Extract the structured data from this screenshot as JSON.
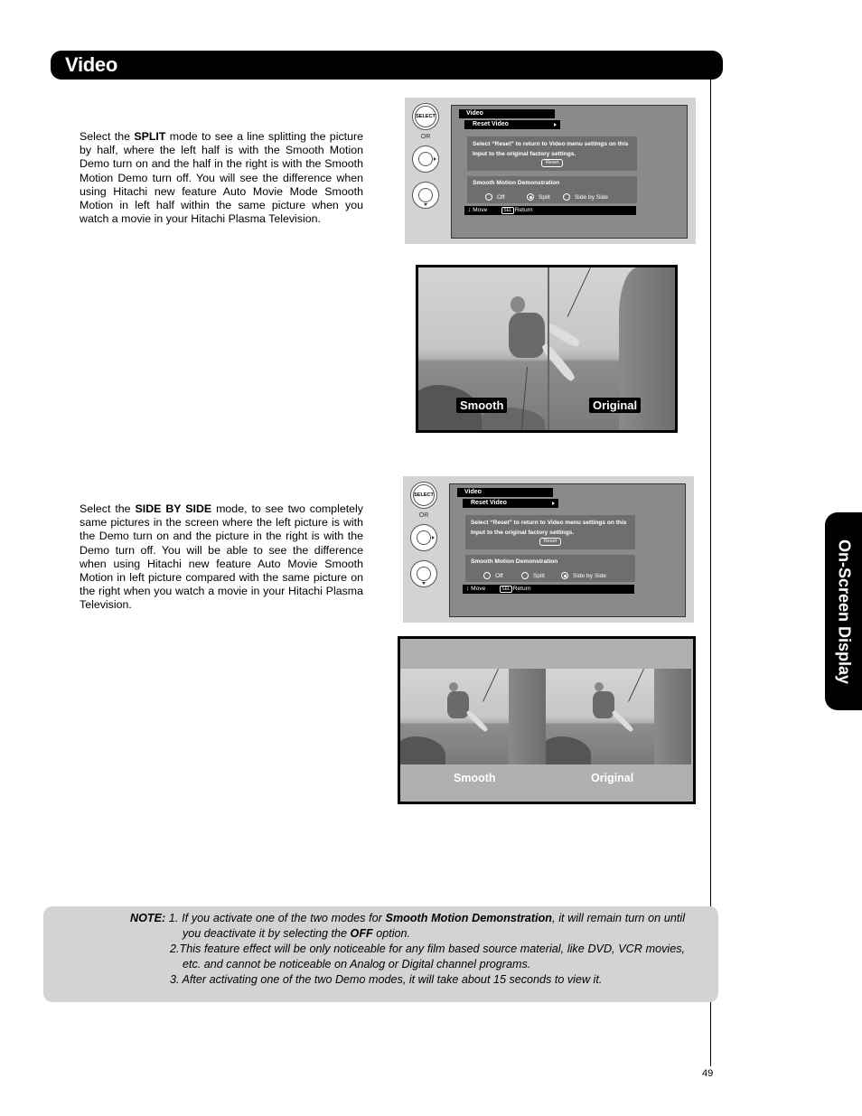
{
  "header": {
    "title": "Video"
  },
  "side_tab": {
    "label": "On-Screen Display"
  },
  "section_split": {
    "text_prefix": "Select the ",
    "mode_name": "SPLIT",
    "text_suffix": " mode to see a line splitting the picture by half, where the left half is with the Smooth Motion Demo turn on and the half in the right is with the Smooth Motion Demo turn off. You will see the difference when using Hitachi new feature Auto Movie Mode Smooth Motion in left half within the same picture when you watch a movie in your Hitachi Plasma Television."
  },
  "section_sbs": {
    "text_prefix": "Select the ",
    "mode_name": "SIDE BY SIDE",
    "text_suffix": " mode, to see two completely same pictures in the screen where the left picture is with the Demo turn on and the picture in the right is with the Demo turn off. You will be able to see the difference when using Hitachi new feature Auto Movie Smooth Motion in left picture compared with the same picture on the right when you watch a movie in your Hitachi Plasma Television."
  },
  "remote": {
    "select_label": "SELECT",
    "or_label": "OR"
  },
  "osd_menus": [
    {
      "menu_title": "Video",
      "submenu": "Reset Video",
      "reset_description": "Select “Reset” to return to Video menu settings on this Input to the original factory settings.",
      "reset_button": "Reset",
      "demo_title": "Smooth Motion Demonstration",
      "options": [
        {
          "label": "Off",
          "selected": false
        },
        {
          "label": "Split",
          "selected": true
        },
        {
          "label": "Side by Side",
          "selected": false
        }
      ],
      "nav_move": "Move",
      "nav_sel": "SEL",
      "nav_return": "Return"
    },
    {
      "menu_title": "Video",
      "submenu": "Reset Video",
      "reset_description": "Select “Reset” to return to Video menu settings on this Input to the original factory settings.",
      "reset_button": "Reset",
      "demo_title": "Smooth Motion Demonstration",
      "options": [
        {
          "label": "Off",
          "selected": false
        },
        {
          "label": "Split",
          "selected": false
        },
        {
          "label": "Side by Side",
          "selected": true
        }
      ],
      "nav_move": "Move",
      "nav_sel": "SEL",
      "nav_return": "Return"
    }
  ],
  "split_image": {
    "left_label": "Smooth",
    "right_label": "Original"
  },
  "sbs_image": {
    "left_label": "Smooth",
    "right_label": "Original"
  },
  "note": {
    "label": "NOTE:",
    "item1_a": "1. If you activate one of the two modes for ",
    "item1_bold": "Smooth Motion Demonstration",
    "item1_b": ", it will remain turn on until you deactivate it by selecting the ",
    "item1_bold2": "OFF",
    "item1_c": " option.",
    "item2": "2.This feature effect will be only noticeable for any film based source material, like DVD, VCR movies, etc. and cannot be noticeable on Analog or Digital channel programs.",
    "item3": "3. After activating one of the two Demo modes, it will take about 15 seconds to view it."
  },
  "page_number": "49"
}
